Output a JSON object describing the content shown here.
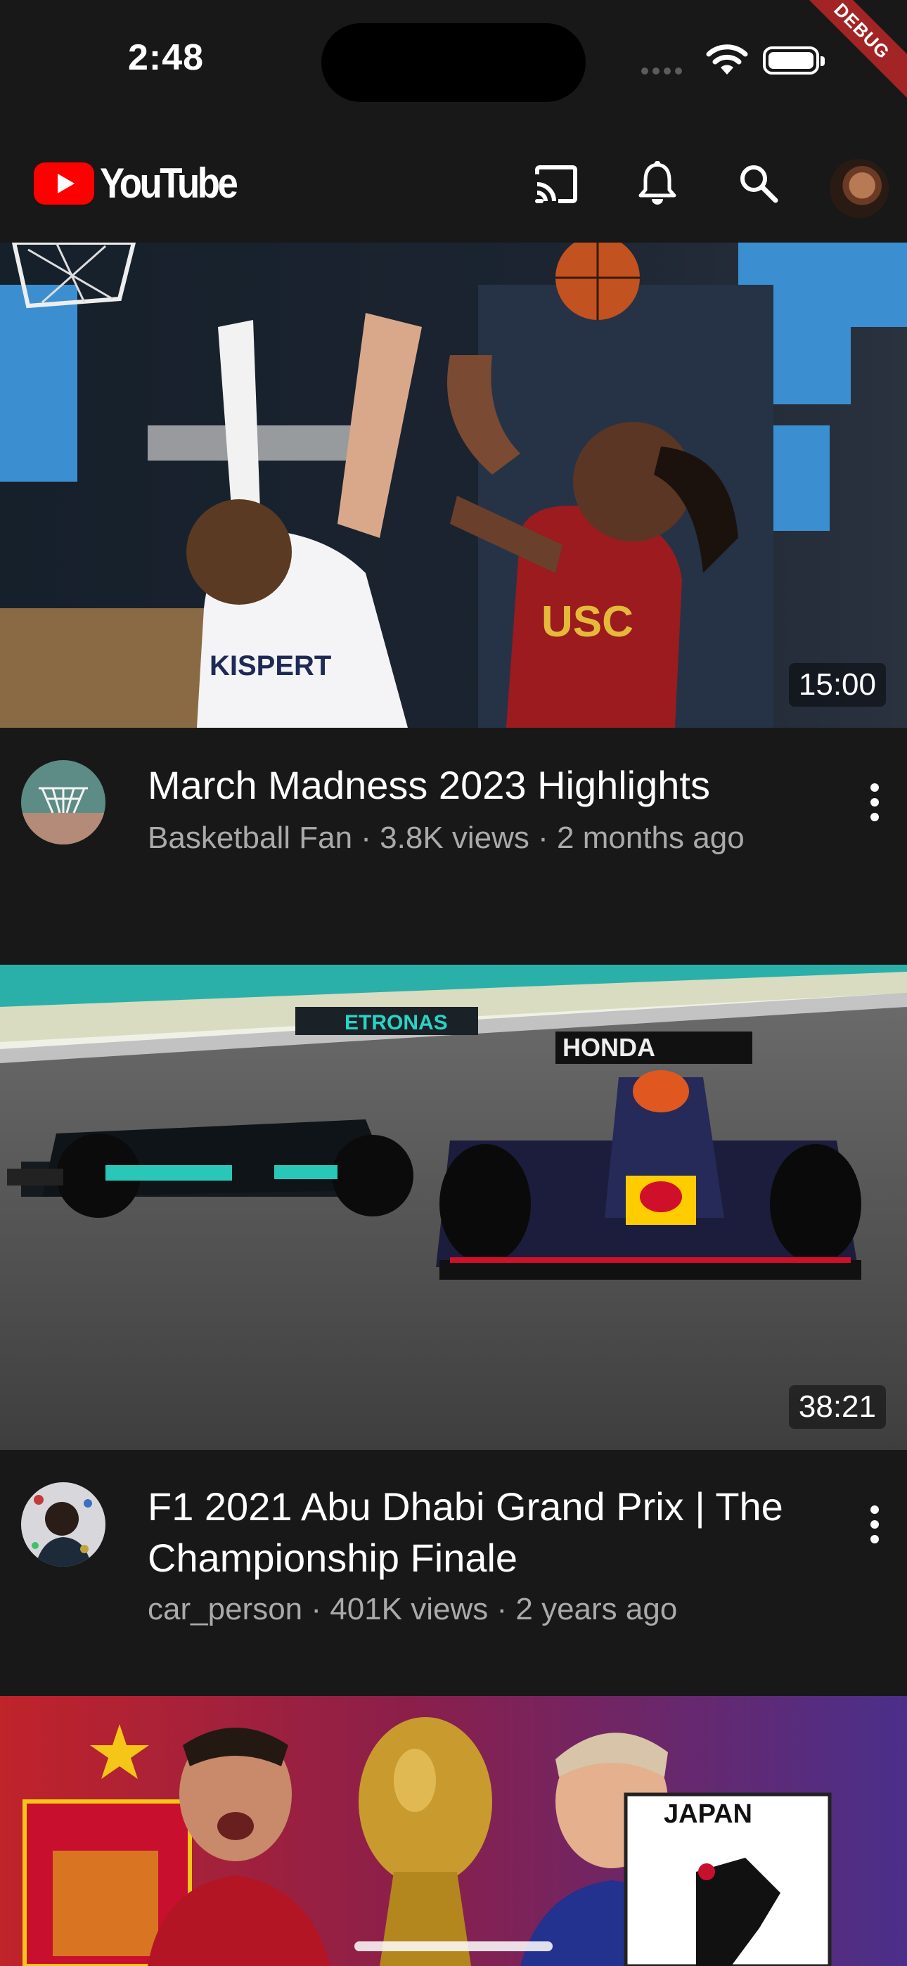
{
  "status_bar": {
    "time": "2:48",
    "debug_banner": "DEBUG"
  },
  "app_bar": {
    "logo_text": "YouTube",
    "icons": [
      "cast-icon",
      "bell-icon",
      "search-icon",
      "avatar"
    ]
  },
  "videos": [
    {
      "title": "March Madness 2023 Highlights",
      "channel": "Basketball Fan",
      "views": "3.8K views",
      "age": "2 months ago",
      "duration": "15:00",
      "thumbnail_text": "KISPERT"
    },
    {
      "title": "F1 2021 Abu Dhabi Grand Prix | The Championship Finale",
      "channel": "car_person",
      "views": "401K views",
      "age": "2 years ago",
      "duration": "38:21",
      "thumbnail_text": "HONDA"
    },
    {
      "title": "",
      "channel": "",
      "views": "",
      "age": "",
      "duration": "",
      "thumbnail_text": "JAPAN"
    }
  ],
  "colors": {
    "background": "#181818",
    "brand_red": "#ff0000",
    "secondary_text": "#aaaaaa"
  }
}
